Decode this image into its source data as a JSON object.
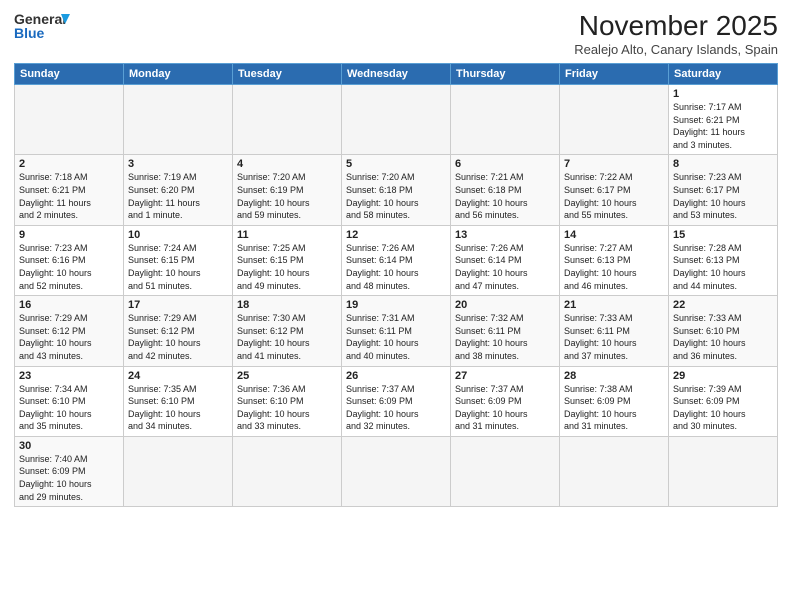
{
  "logo": {
    "line1": "General",
    "line2": "Blue"
  },
  "title": "November 2025",
  "location": "Realejo Alto, Canary Islands, Spain",
  "days_header": [
    "Sunday",
    "Monday",
    "Tuesday",
    "Wednesday",
    "Thursday",
    "Friday",
    "Saturday"
  ],
  "weeks": [
    [
      {
        "num": "",
        "info": ""
      },
      {
        "num": "",
        "info": ""
      },
      {
        "num": "",
        "info": ""
      },
      {
        "num": "",
        "info": ""
      },
      {
        "num": "",
        "info": ""
      },
      {
        "num": "",
        "info": ""
      },
      {
        "num": "1",
        "info": "Sunrise: 7:17 AM\nSunset: 6:21 PM\nDaylight: 11 hours\nand 3 minutes."
      }
    ],
    [
      {
        "num": "2",
        "info": "Sunrise: 7:18 AM\nSunset: 6:21 PM\nDaylight: 11 hours\nand 2 minutes."
      },
      {
        "num": "3",
        "info": "Sunrise: 7:19 AM\nSunset: 6:20 PM\nDaylight: 11 hours\nand 1 minute."
      },
      {
        "num": "4",
        "info": "Sunrise: 7:20 AM\nSunset: 6:19 PM\nDaylight: 10 hours\nand 59 minutes."
      },
      {
        "num": "5",
        "info": "Sunrise: 7:20 AM\nSunset: 6:18 PM\nDaylight: 10 hours\nand 58 minutes."
      },
      {
        "num": "6",
        "info": "Sunrise: 7:21 AM\nSunset: 6:18 PM\nDaylight: 10 hours\nand 56 minutes."
      },
      {
        "num": "7",
        "info": "Sunrise: 7:22 AM\nSunset: 6:17 PM\nDaylight: 10 hours\nand 55 minutes."
      },
      {
        "num": "8",
        "info": "Sunrise: 7:23 AM\nSunset: 6:17 PM\nDaylight: 10 hours\nand 53 minutes."
      }
    ],
    [
      {
        "num": "9",
        "info": "Sunrise: 7:23 AM\nSunset: 6:16 PM\nDaylight: 10 hours\nand 52 minutes."
      },
      {
        "num": "10",
        "info": "Sunrise: 7:24 AM\nSunset: 6:15 PM\nDaylight: 10 hours\nand 51 minutes."
      },
      {
        "num": "11",
        "info": "Sunrise: 7:25 AM\nSunset: 6:15 PM\nDaylight: 10 hours\nand 49 minutes."
      },
      {
        "num": "12",
        "info": "Sunrise: 7:26 AM\nSunset: 6:14 PM\nDaylight: 10 hours\nand 48 minutes."
      },
      {
        "num": "13",
        "info": "Sunrise: 7:26 AM\nSunset: 6:14 PM\nDaylight: 10 hours\nand 47 minutes."
      },
      {
        "num": "14",
        "info": "Sunrise: 7:27 AM\nSunset: 6:13 PM\nDaylight: 10 hours\nand 46 minutes."
      },
      {
        "num": "15",
        "info": "Sunrise: 7:28 AM\nSunset: 6:13 PM\nDaylight: 10 hours\nand 44 minutes."
      }
    ],
    [
      {
        "num": "16",
        "info": "Sunrise: 7:29 AM\nSunset: 6:12 PM\nDaylight: 10 hours\nand 43 minutes."
      },
      {
        "num": "17",
        "info": "Sunrise: 7:29 AM\nSunset: 6:12 PM\nDaylight: 10 hours\nand 42 minutes."
      },
      {
        "num": "18",
        "info": "Sunrise: 7:30 AM\nSunset: 6:12 PM\nDaylight: 10 hours\nand 41 minutes."
      },
      {
        "num": "19",
        "info": "Sunrise: 7:31 AM\nSunset: 6:11 PM\nDaylight: 10 hours\nand 40 minutes."
      },
      {
        "num": "20",
        "info": "Sunrise: 7:32 AM\nSunset: 6:11 PM\nDaylight: 10 hours\nand 38 minutes."
      },
      {
        "num": "21",
        "info": "Sunrise: 7:33 AM\nSunset: 6:11 PM\nDaylight: 10 hours\nand 37 minutes."
      },
      {
        "num": "22",
        "info": "Sunrise: 7:33 AM\nSunset: 6:10 PM\nDaylight: 10 hours\nand 36 minutes."
      }
    ],
    [
      {
        "num": "23",
        "info": "Sunrise: 7:34 AM\nSunset: 6:10 PM\nDaylight: 10 hours\nand 35 minutes."
      },
      {
        "num": "24",
        "info": "Sunrise: 7:35 AM\nSunset: 6:10 PM\nDaylight: 10 hours\nand 34 minutes."
      },
      {
        "num": "25",
        "info": "Sunrise: 7:36 AM\nSunset: 6:10 PM\nDaylight: 10 hours\nand 33 minutes."
      },
      {
        "num": "26",
        "info": "Sunrise: 7:37 AM\nSunset: 6:09 PM\nDaylight: 10 hours\nand 32 minutes."
      },
      {
        "num": "27",
        "info": "Sunrise: 7:37 AM\nSunset: 6:09 PM\nDaylight: 10 hours\nand 31 minutes."
      },
      {
        "num": "28",
        "info": "Sunrise: 7:38 AM\nSunset: 6:09 PM\nDaylight: 10 hours\nand 31 minutes."
      },
      {
        "num": "29",
        "info": "Sunrise: 7:39 AM\nSunset: 6:09 PM\nDaylight: 10 hours\nand 30 minutes."
      }
    ],
    [
      {
        "num": "30",
        "info": "Sunrise: 7:40 AM\nSunset: 6:09 PM\nDaylight: 10 hours\nand 29 minutes."
      },
      {
        "num": "",
        "info": ""
      },
      {
        "num": "",
        "info": ""
      },
      {
        "num": "",
        "info": ""
      },
      {
        "num": "",
        "info": ""
      },
      {
        "num": "",
        "info": ""
      },
      {
        "num": "",
        "info": ""
      }
    ]
  ]
}
